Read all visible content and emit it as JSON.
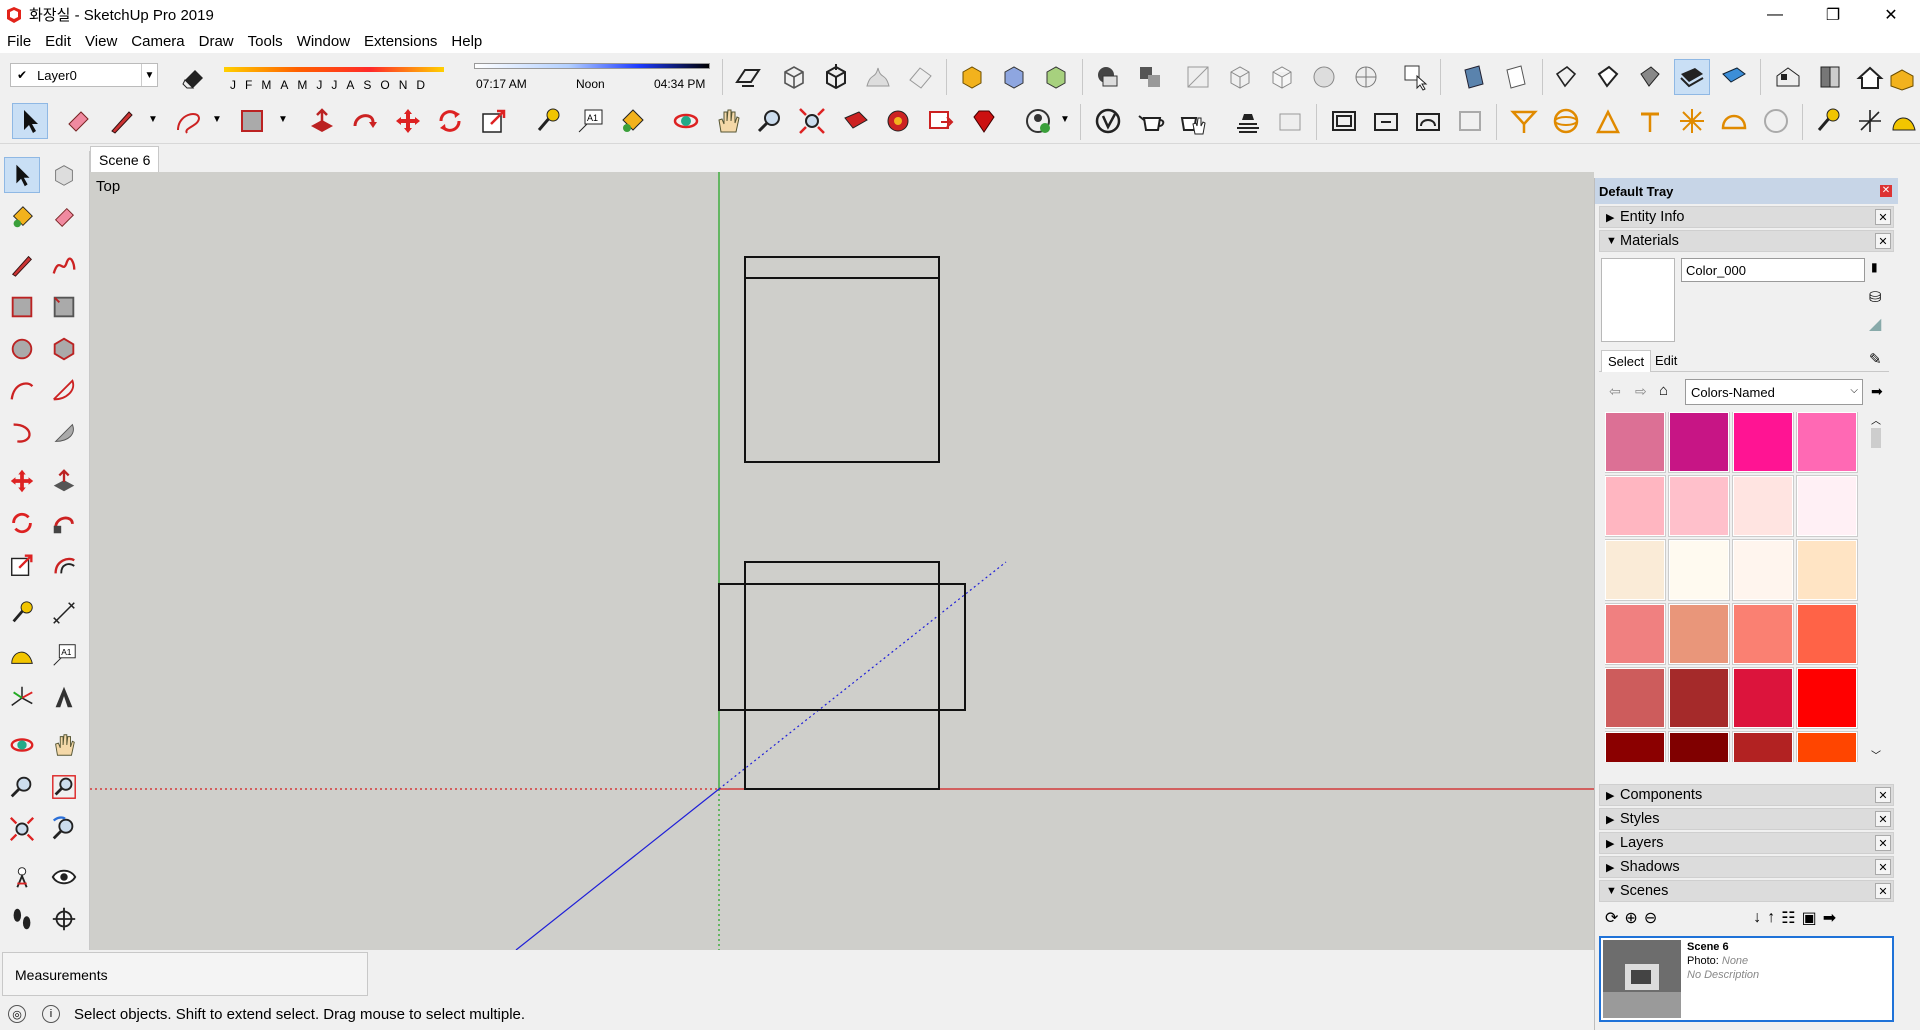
{
  "window": {
    "title": "화장실 - SketchUp Pro 2019",
    "minimize": "—",
    "restore": "❐",
    "close": "✕"
  },
  "menu": [
    "File",
    "Edit",
    "View",
    "Camera",
    "Draw",
    "Tools",
    "Window",
    "Extensions",
    "Help"
  ],
  "layer": {
    "current": "Layer0"
  },
  "shadow": {
    "months": [
      "J",
      "F",
      "M",
      "A",
      "M",
      "J",
      "J",
      "A",
      "S",
      "O",
      "N",
      "D"
    ],
    "sunrise": "07:17 AM",
    "noon": "Noon",
    "sunset": "04:34 PM"
  },
  "scene_tab": "Scene 6",
  "view_name": "Top",
  "tray": {
    "title": "Default Tray",
    "panels": {
      "entity_info": "Entity Info",
      "materials": "Materials",
      "components": "Components",
      "styles": "Styles",
      "layers": "Layers",
      "shadows": "Shadows",
      "scenes": "Scenes"
    },
    "materials": {
      "name": "Color_000",
      "tabs": [
        "Select",
        "Edit"
      ],
      "library": "Colors-Named",
      "swatches": [
        [
          "#dc7095",
          "#c71585",
          "#ff1493",
          "#ff69b4"
        ],
        [
          "#ffb6c1",
          "#ffc0cb",
          "#ffe4e1",
          "#fff0f5"
        ],
        [
          "#faebd7",
          "#fffaf0",
          "#fff5ee",
          "#ffe4c4"
        ],
        [
          "#f08080",
          "#e9967a",
          "#fa8072",
          "#ff6347"
        ],
        [
          "#cd5c5c",
          "#a52a2a",
          "#dc143c",
          "#ff0000"
        ],
        [
          "#8b0000",
          "#800000",
          "#b22222",
          "#ff4500"
        ]
      ]
    },
    "scene_card": {
      "name": "Scene 6",
      "photo_label": "Photo:",
      "photo_value": "None",
      "description": "No Description"
    }
  },
  "measurements_label": "Measurements",
  "status_text": "Select objects. Shift to extend select. Drag mouse to select multiple.",
  "colors": {
    "viewport": "#cfcfcb",
    "axis_red": "#d41f1f",
    "axis_green": "#1ea61e",
    "axis_blue": "#1f1fd8",
    "accent": "#1f72d8"
  }
}
